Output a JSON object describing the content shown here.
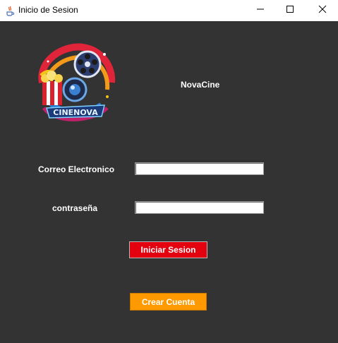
{
  "window": {
    "title": "Inicio de Sesion",
    "controls": [
      "minimize-icon",
      "maximize-icon",
      "close-icon"
    ]
  },
  "brand": {
    "name": "NovaCine",
    "logo_text": "CINENOVA"
  },
  "form": {
    "email_label": "Correo Electronico",
    "email_value": "",
    "password_label": "contraseña",
    "password_value": ""
  },
  "buttons": {
    "login_label": "Iniciar Sesion",
    "create_label": "Crear Cuenta"
  },
  "colors": {
    "background": "#333333",
    "login_button": "#e3000f",
    "create_button": "#ff9900"
  }
}
